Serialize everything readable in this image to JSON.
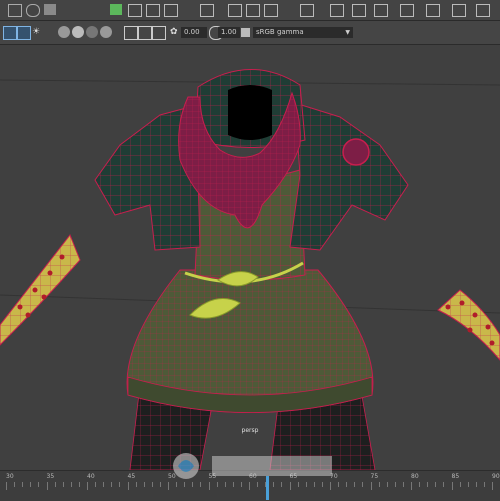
{
  "panel_bar": {
    "exposure_value": "0.00",
    "gamma_value": "1.00",
    "color_management": "sRGB gamma"
  },
  "viewport": {
    "camera_label": "persp"
  },
  "timeline": {
    "frame_labels": [
      "30",
      "35",
      "40",
      "45",
      "50",
      "55",
      "60",
      "65",
      "70",
      "75",
      "80",
      "85",
      "90"
    ]
  },
  "colors": {
    "wire": "#c81e4e",
    "scarf": "#7d1e46",
    "jacket": "#1f3d35",
    "dress": "#4e5a38",
    "belt": "#c7d24a",
    "bat": "#c9b84a",
    "accent": "#4aa0d8"
  }
}
